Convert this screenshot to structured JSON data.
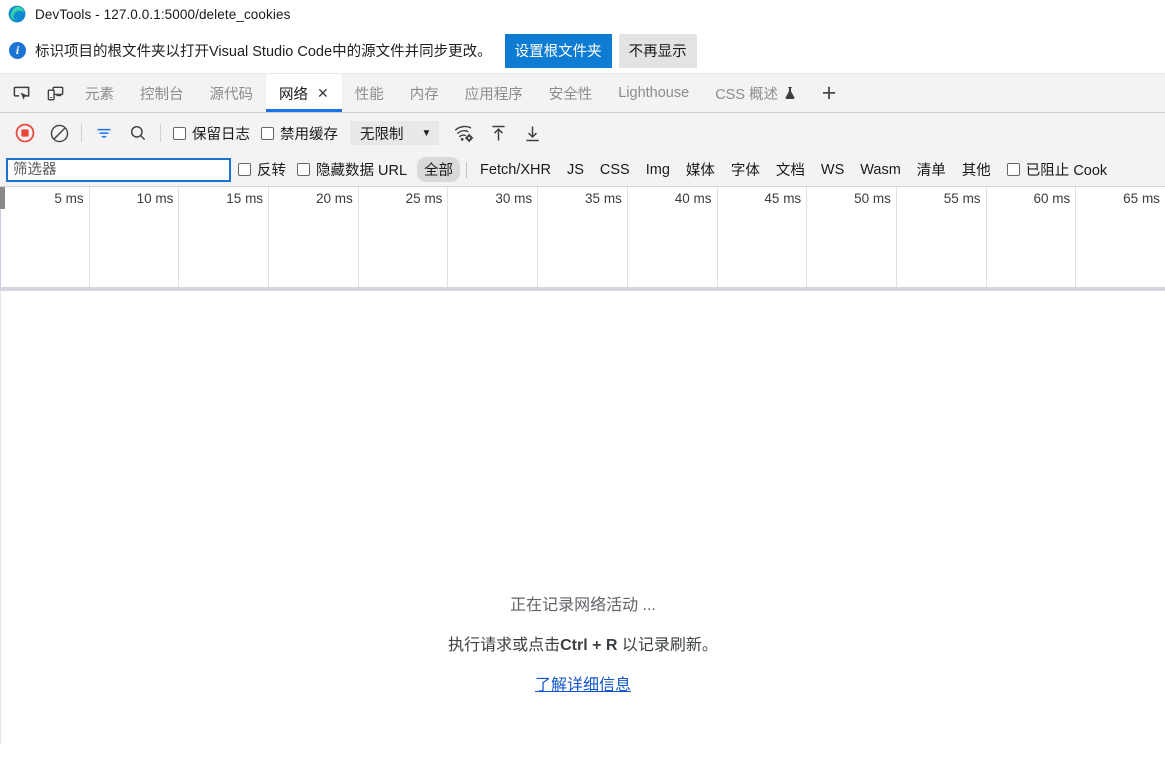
{
  "window": {
    "title": "DevTools - 127.0.0.1:5000/delete_cookies",
    "logo_icon": "edge-logo"
  },
  "infobar": {
    "icon": "info-circle-icon",
    "message": "标识项目的根文件夹以打开Visual Studio Code中的源文件并同步更改。",
    "primary_button": "设置根文件夹",
    "secondary_button": "不再显示",
    "primary_color": "#0f7cd4",
    "secondary_color": "#e3e3e3"
  },
  "tabbar": {
    "inspect_icon": "inspect-element-icon",
    "device_icon": "device-toolbar-icon",
    "add_label": "+",
    "tabs": [
      {
        "label": "元素",
        "active": false
      },
      {
        "label": "控制台",
        "active": false
      },
      {
        "label": "源代码",
        "active": false
      },
      {
        "label": "网络",
        "active": true,
        "closable": true,
        "close_label": "✕"
      },
      {
        "label": "性能",
        "active": false
      },
      {
        "label": "内存",
        "active": false
      },
      {
        "label": "应用程序",
        "active": false
      },
      {
        "label": "安全性",
        "active": false
      },
      {
        "label": "Lighthouse",
        "active": false
      },
      {
        "label": "CSS 概述",
        "active": false,
        "experimental": true
      }
    ],
    "active_underline_color": "#1a73e8"
  },
  "toolbar": {
    "record_icon": "record-stop-icon",
    "record_color": "#e8483a",
    "clear_icon": "clear-icon",
    "filter_icon": "filter-icon",
    "filter_icon_color": "#1a73e8",
    "search_icon": "search-icon",
    "preserve_log_label": "保留日志",
    "preserve_log_checked": false,
    "disable_cache_label": "禁用缓存",
    "disable_cache_checked": false,
    "throttling_value": "无限制",
    "throttling_caret": "▼",
    "network_conditions_icon": "wifi-settings-icon",
    "import_har_icon": "import-har-icon",
    "export_har_icon": "export-har-icon"
  },
  "filterbar": {
    "input_value": "",
    "input_placeholder": "筛选器",
    "invert_label": "反转",
    "invert_checked": false,
    "hide_data_urls_label": "隐藏数据 URL",
    "hide_data_urls_checked": false,
    "types": [
      {
        "label": "全部",
        "selected": true
      },
      {
        "label": "Fetch/XHR",
        "selected": false
      },
      {
        "label": "JS",
        "selected": false
      },
      {
        "label": "CSS",
        "selected": false
      },
      {
        "label": "Img",
        "selected": false
      },
      {
        "label": "媒体",
        "selected": false
      },
      {
        "label": "字体",
        "selected": false
      },
      {
        "label": "文档",
        "selected": false
      },
      {
        "label": "WS",
        "selected": false
      },
      {
        "label": "Wasm",
        "selected": false
      },
      {
        "label": "清单",
        "selected": false
      },
      {
        "label": "其他",
        "selected": false
      }
    ],
    "blocked_cookies_label": "已阻止 Cook",
    "blocked_cookies_checked": false
  },
  "overview": {
    "ticks": [
      "5 ms",
      "10 ms",
      "15 ms",
      "20 ms",
      "25 ms",
      "30 ms",
      "35 ms",
      "40 ms",
      "45 ms",
      "50 ms",
      "55 ms",
      "60 ms",
      "65 ms"
    ]
  },
  "empty_state": {
    "line1": "正在记录网络活动 ...",
    "line2_prefix": "执行请求或点击",
    "line2_shortcut": "Ctrl + R",
    "line2_suffix": " 以记录刷新。",
    "link": "了解详细信息",
    "link_color": "#1155cc"
  }
}
